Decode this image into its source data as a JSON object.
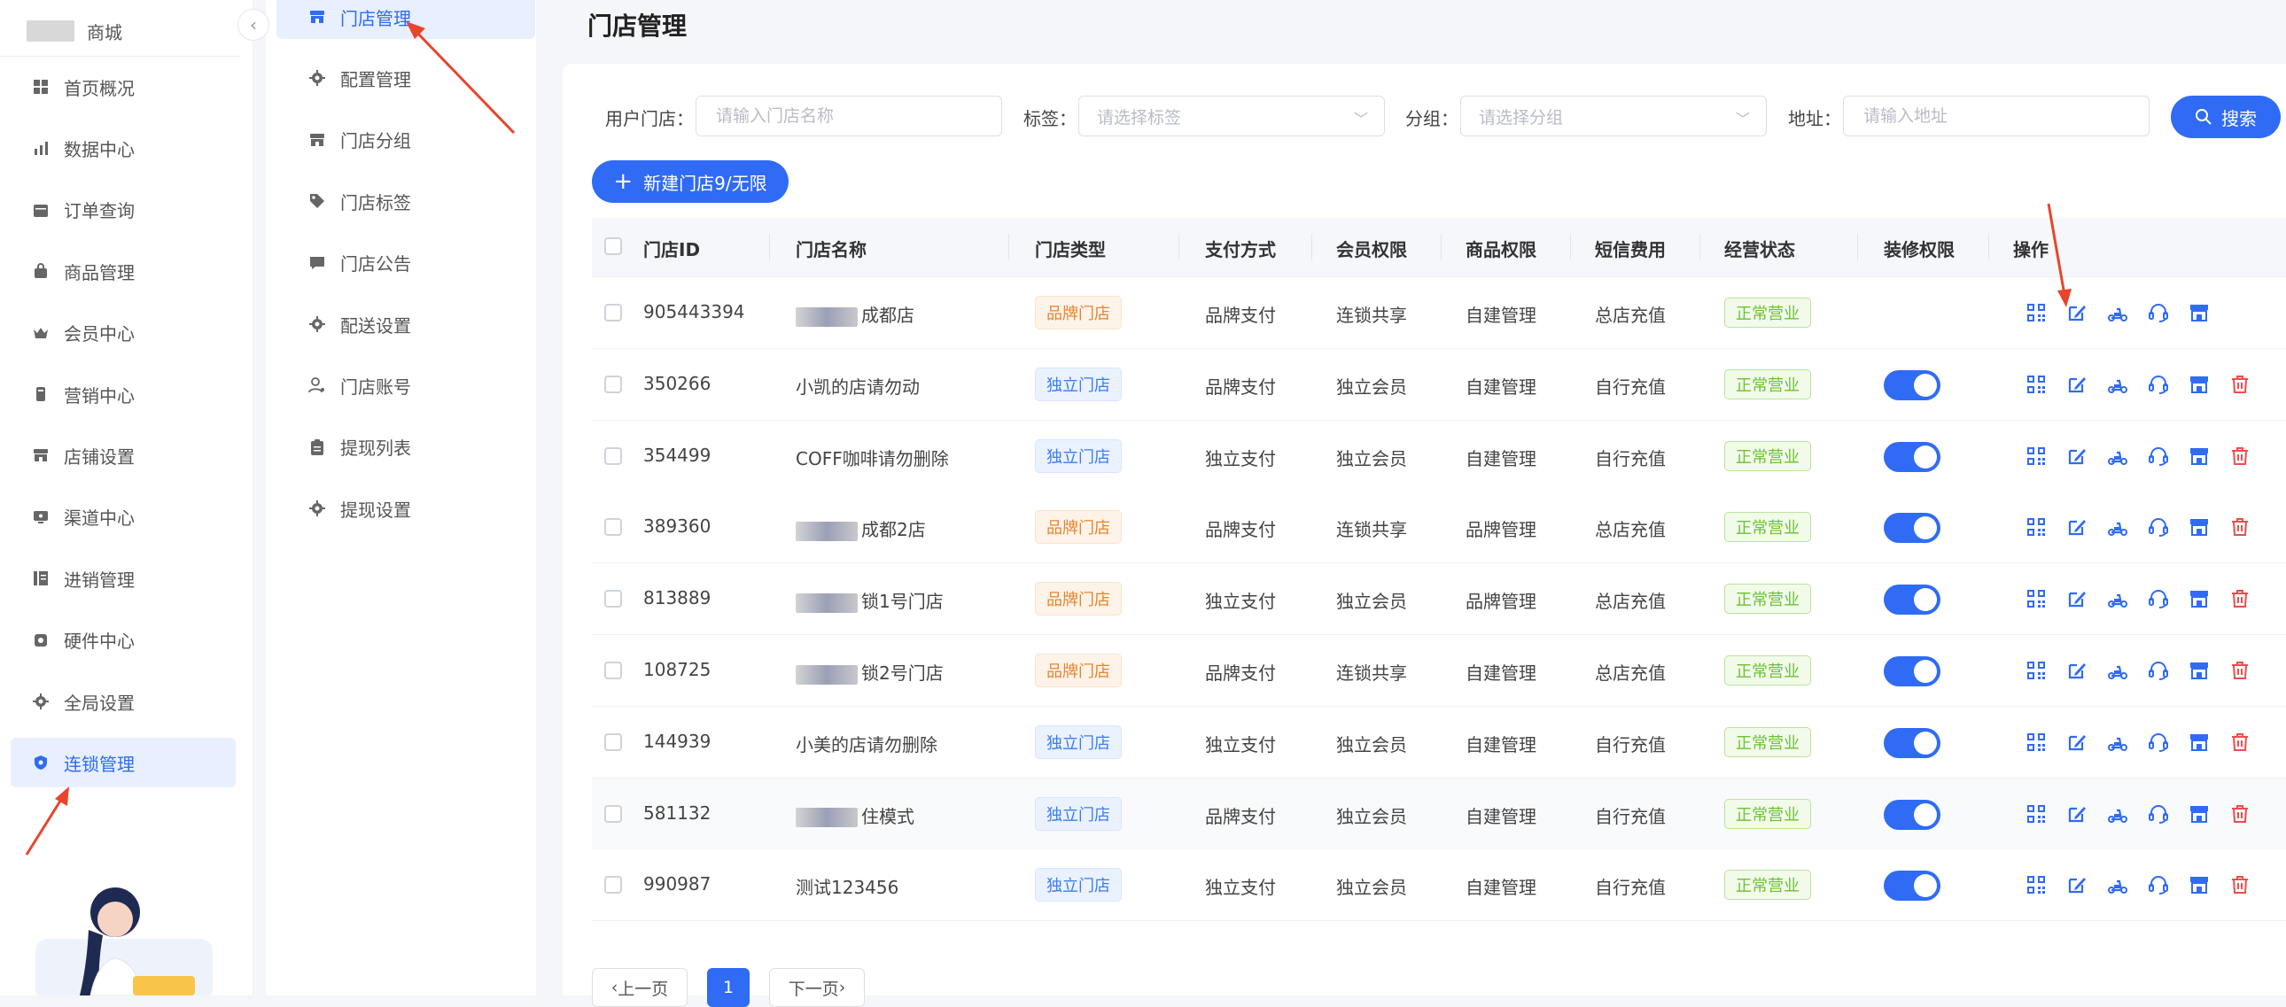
{
  "sidebar": {
    "brand_text": "商城",
    "items": [
      {
        "label": "首页概况",
        "icon": "grid-icon"
      },
      {
        "label": "数据中心",
        "icon": "bar-chart-icon"
      },
      {
        "label": "订单查询",
        "icon": "calendar-icon"
      },
      {
        "label": "商品管理",
        "icon": "bag-icon"
      },
      {
        "label": "会员中心",
        "icon": "crown-icon"
      },
      {
        "label": "营销中心",
        "icon": "phone-icon"
      },
      {
        "label": "店铺设置",
        "icon": "store-icon"
      },
      {
        "label": "渠道中心",
        "icon": "monitor-icon"
      },
      {
        "label": "进销管理",
        "icon": "list-icon"
      },
      {
        "label": "硬件中心",
        "icon": "hardware-icon"
      },
      {
        "label": "全局设置",
        "icon": "gear-icon"
      },
      {
        "label": "连锁管理",
        "icon": "shield-icon",
        "active": true
      }
    ]
  },
  "subsidebar": {
    "items": [
      {
        "label": "门店管理",
        "icon": "store-icon",
        "active": true
      },
      {
        "label": "配置管理",
        "icon": "gear-icon"
      },
      {
        "label": "门店分组",
        "icon": "store-icon"
      },
      {
        "label": "门店标签",
        "icon": "tag-icon"
      },
      {
        "label": "门店公告",
        "icon": "message-icon"
      },
      {
        "label": "配送设置",
        "icon": "gear-icon"
      },
      {
        "label": "门店账号",
        "icon": "user-icon"
      },
      {
        "label": "提现列表",
        "icon": "clipboard-icon"
      },
      {
        "label": "提现设置",
        "icon": "gear-icon"
      }
    ]
  },
  "page_title": "门店管理",
  "filters": {
    "store_label": "用户门店：",
    "store_placeholder": "请输入门店名称",
    "tag_label": "标签：",
    "tag_placeholder": "请选择标签",
    "group_label": "分组：",
    "group_placeholder": "请选择分组",
    "address_label": "地址：",
    "address_placeholder": "请输入地址",
    "search_label": "搜索"
  },
  "new_store_label": "新建门店9/无限",
  "table": {
    "headers": [
      "门店ID",
      "门店名称",
      "门店类型",
      "支付方式",
      "会员权限",
      "商品权限",
      "短信费用",
      "经营状态",
      "装修权限",
      "操作"
    ],
    "rows": [
      {
        "id": "905443394",
        "name": "成都店",
        "type": "品牌门店",
        "pay": "品牌支付",
        "member": "连锁共享",
        "goods": "自建管理",
        "sms": "总店充值",
        "status": "正常营业",
        "decor": false,
        "delete": false
      },
      {
        "id": "350266",
        "name": "小凯的店请勿动",
        "type": "独立门店",
        "pay": "品牌支付",
        "member": "独立会员",
        "goods": "自建管理",
        "sms": "自行充值",
        "status": "正常营业",
        "decor": true,
        "delete": true
      },
      {
        "id": "354499",
        "name": "COFF咖啡请勿删除",
        "type": "独立门店",
        "pay": "独立支付",
        "member": "独立会员",
        "goods": "自建管理",
        "sms": "自行充值",
        "status": "正常营业",
        "decor": true,
        "delete": true
      },
      {
        "id": "389360",
        "name": "成都2店",
        "type": "品牌门店",
        "pay": "品牌支付",
        "member": "连锁共享",
        "goods": "品牌管理",
        "sms": "总店充值",
        "status": "正常营业",
        "decor": true,
        "delete": true
      },
      {
        "id": "813889",
        "name": "锁1号门店",
        "type": "品牌门店",
        "pay": "独立支付",
        "member": "独立会员",
        "goods": "品牌管理",
        "sms": "总店充值",
        "status": "正常营业",
        "decor": true,
        "delete": true
      },
      {
        "id": "108725",
        "name": "锁2号门店",
        "type": "品牌门店",
        "pay": "品牌支付",
        "member": "连锁共享",
        "goods": "自建管理",
        "sms": "总店充值",
        "status": "正常营业",
        "decor": true,
        "delete": true
      },
      {
        "id": "144939",
        "name": "小美的店请勿删除",
        "type": "独立门店",
        "pay": "独立支付",
        "member": "独立会员",
        "goods": "自建管理",
        "sms": "自行充值",
        "status": "正常营业",
        "decor": true,
        "delete": true
      },
      {
        "id": "581132",
        "name": "住模式",
        "type": "独立门店",
        "pay": "品牌支付",
        "member": "独立会员",
        "goods": "自建管理",
        "sms": "自行充值",
        "status": "正常营业",
        "decor": true,
        "delete": true
      },
      {
        "id": "990987",
        "name": "测试123456",
        "type": "独立门店",
        "pay": "独立支付",
        "member": "独立会员",
        "goods": "自建管理",
        "sms": "自行充值",
        "status": "正常营业",
        "decor": true,
        "delete": true
      }
    ]
  },
  "pagination": {
    "prev": "上一页",
    "current": "1",
    "next": "下一页"
  },
  "colors": {
    "primary": "#2f6bf5",
    "brand_tag": "#e8842c",
    "status": "#6cc133",
    "delete": "#f04c4c",
    "arrow": "#e8452c"
  }
}
